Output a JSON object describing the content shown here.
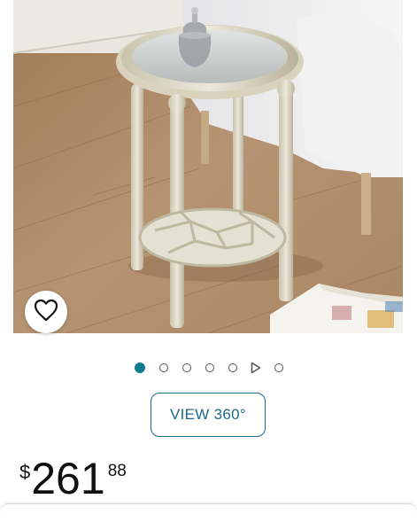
{
  "product": {
    "image_alt": "Round glass-top side table with two tiers in champagne finish",
    "wishlist_icon": "heart-icon"
  },
  "carousel": {
    "count": 7,
    "active_index": 0,
    "video_index": 5
  },
  "view360": {
    "label": "VIEW 360°"
  },
  "price": {
    "symbol": "$",
    "whole": "261",
    "fraction": "88"
  },
  "colors": {
    "accent": "#0f7c90",
    "button_border": "#1c6a8a",
    "text": "#0f1111"
  }
}
